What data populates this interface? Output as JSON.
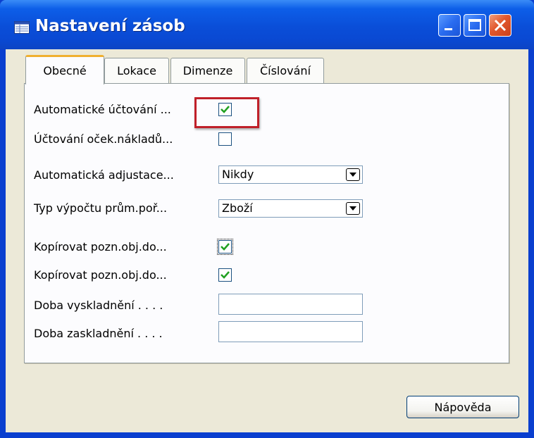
{
  "window": {
    "title": "Nastavení zásob",
    "icon": "form-icon"
  },
  "tabs": [
    {
      "label": "Obecné",
      "active": true
    },
    {
      "label": "Lokace",
      "active": false
    },
    {
      "label": "Dimenze",
      "active": false
    },
    {
      "label": "Číslování",
      "active": false
    }
  ],
  "fields": {
    "auto_posting": {
      "label": "Automatické účtování ...",
      "checked": true
    },
    "expected_cost_posting": {
      "label": "Účtování oček.nákladů...",
      "checked": false
    },
    "auto_adjust": {
      "label": "Automatická adjustace...",
      "value": "Nikdy"
    },
    "avg_cost_calc_type": {
      "label": "Typ výpočtu prům.poř...",
      "value": "Zboží"
    },
    "copy_comments_1": {
      "label": "Kopírovat pozn.obj.do...",
      "checked": true
    },
    "copy_comments_2": {
      "label": "Kopírovat pozn.obj.do...",
      "checked": true
    },
    "outbound_whse_time": {
      "label": "Doba vyskladnění . . . .",
      "value": ""
    },
    "inbound_whse_time": {
      "label": "Doba zaskladnění . . . .",
      "value": ""
    }
  },
  "buttons": {
    "help": "Nápověda"
  },
  "colors": {
    "titlebar": "#0a4ed8",
    "dialog_bg": "#ece9d8",
    "highlight_box": "#c0202a",
    "check_mark": "#21a121"
  }
}
